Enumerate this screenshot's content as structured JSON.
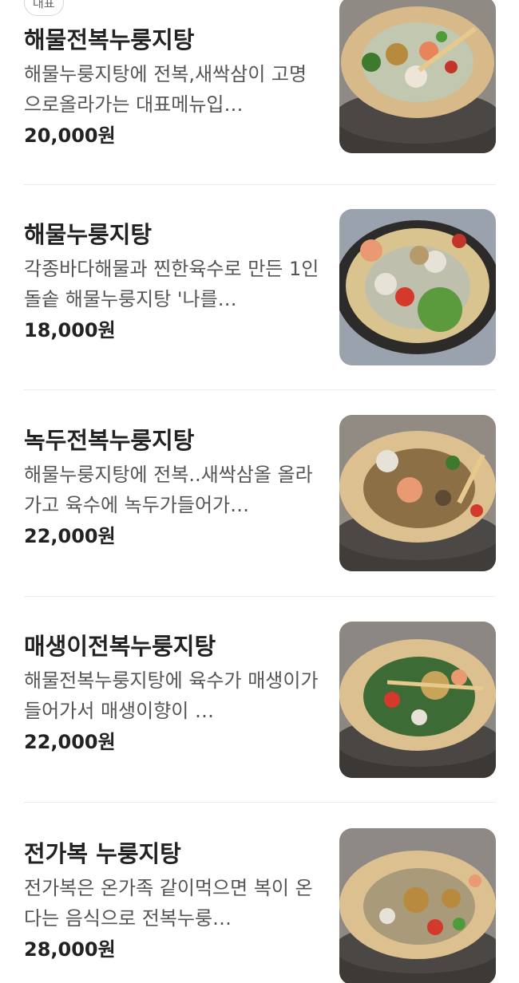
{
  "badge_label": "대표",
  "menu_items": [
    {
      "name": "해물전복누룽지탕",
      "description": "해물누룽지탕에 전복,새싹삼이 고명으로올라가는 대표메뉴입…",
      "price": "20,000원",
      "image_icon": "seafood-abalone-nurungji-pot-photo"
    },
    {
      "name": "해물누룽지탕",
      "description": "각종바다해물과 찐한육수로 만든 1인돌솥 해물누룽지탕 '나를…",
      "price": "18,000원",
      "image_icon": "seafood-nurungji-pot-photo"
    },
    {
      "name": "녹두전복누룽지탕",
      "description": "해물누룽지탕에 전복..새싹삼올 올라가고 육수에 녹두가들어가…",
      "price": "22,000원",
      "image_icon": "mungbean-abalone-nurungji-pot-photo"
    },
    {
      "name": "매생이전복누룽지탕",
      "description": "해물전복누룽지탕에 육수가 매생이가 들어가서 매생이향이 …",
      "price": "22,000원",
      "image_icon": "seaweed-abalone-nurungji-pot-photo"
    },
    {
      "name": "전가복 누룽지탕",
      "description": "전가복은 온가족 같이먹으면 복이 온다는 음식으로 전복누룽…",
      "price": "28,000원",
      "image_icon": "jeongabok-nurungji-pot-photo"
    }
  ]
}
